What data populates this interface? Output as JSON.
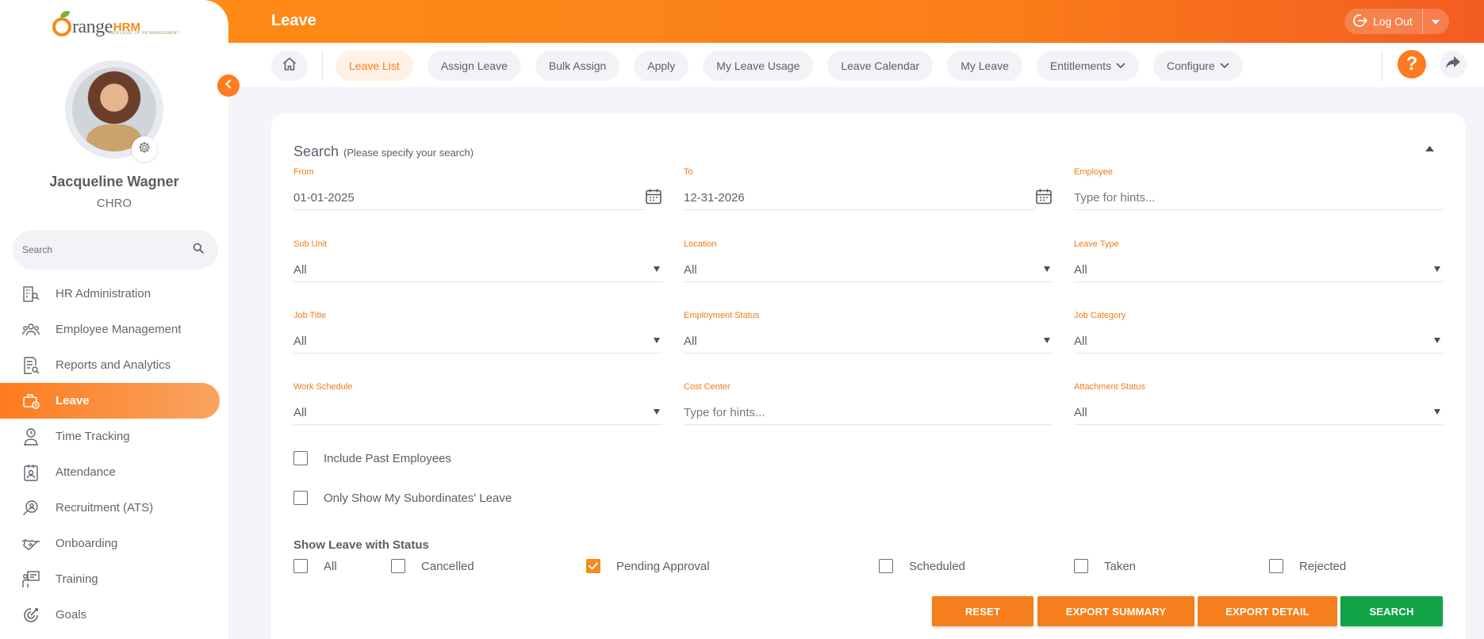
{
  "brand": {
    "logo_main": "range",
    "logo_hrm": "HRM",
    "logo_tagline": "NEW LEVEL OF HR MANAGEMENT",
    "accent": "#ff7b1d"
  },
  "user": {
    "name": "Jacqueline Wagner",
    "role": "CHRO"
  },
  "sidebar": {
    "search_placeholder": "Search",
    "items": [
      {
        "label": "HR Administration",
        "icon": "building-person-icon",
        "active": false
      },
      {
        "label": "Employee Management",
        "icon": "people-group-icon",
        "active": false
      },
      {
        "label": "Reports and Analytics",
        "icon": "report-search-icon",
        "active": false
      },
      {
        "label": "Leave",
        "icon": "suitcase-icon",
        "active": true
      },
      {
        "label": "Time Tracking",
        "icon": "clock-person-icon",
        "active": false
      },
      {
        "label": "Attendance",
        "icon": "attendance-badge-icon",
        "active": false
      },
      {
        "label": "Recruitment (ATS)",
        "icon": "recruit-search-icon",
        "active": false
      },
      {
        "label": "Onboarding",
        "icon": "handshake-icon",
        "active": false
      },
      {
        "label": "Training",
        "icon": "presentation-icon",
        "active": false
      },
      {
        "label": "Goals",
        "icon": "target-icon",
        "active": false
      }
    ]
  },
  "header": {
    "title": "Leave",
    "logout_label": "Log Out"
  },
  "subnav": {
    "tabs": [
      {
        "label": "Leave List",
        "active": true,
        "dropdown": false
      },
      {
        "label": "Assign Leave",
        "active": false,
        "dropdown": false
      },
      {
        "label": "Bulk Assign",
        "active": false,
        "dropdown": false
      },
      {
        "label": "Apply",
        "active": false,
        "dropdown": false
      },
      {
        "label": "My Leave Usage",
        "active": false,
        "dropdown": false
      },
      {
        "label": "Leave Calendar",
        "active": false,
        "dropdown": false
      },
      {
        "label": "My Leave",
        "active": false,
        "dropdown": false
      },
      {
        "label": "Entitlements",
        "active": false,
        "dropdown": true
      },
      {
        "label": "Configure",
        "active": false,
        "dropdown": true
      }
    ],
    "help_label": "?"
  },
  "search": {
    "title": "Search",
    "hint": "(Please specify your search)",
    "fields": {
      "from": {
        "label": "From",
        "value": "01-01-2025"
      },
      "to": {
        "label": "To",
        "value": "12-31-2026"
      },
      "employee": {
        "label": "Employee",
        "placeholder": "Type for hints..."
      },
      "sub_unit": {
        "label": "Sub Unit",
        "value": "All"
      },
      "location": {
        "label": "Location",
        "value": "All"
      },
      "leave_type": {
        "label": "Leave Type",
        "value": "All"
      },
      "job_title": {
        "label": "Job Title",
        "value": "All"
      },
      "employment_status": {
        "label": "Employment Status",
        "value": "All"
      },
      "job_category": {
        "label": "Job Category",
        "value": "All"
      },
      "work_schedule": {
        "label": "Work Schedule",
        "value": "All"
      },
      "cost_center": {
        "label": "Cost Center",
        "placeholder": "Type for hints..."
      },
      "attachment_status": {
        "label": "Attachment Status",
        "value": "All"
      }
    },
    "include_past": {
      "label": "Include Past Employees",
      "checked": false
    },
    "only_subordinates": {
      "label": "Only Show My Subordinates' Leave",
      "checked": false
    },
    "status_heading": "Show Leave with Status",
    "statuses": [
      {
        "label": "All",
        "checked": false
      },
      {
        "label": "Cancelled",
        "checked": false
      },
      {
        "label": "Pending Approval",
        "checked": true
      },
      {
        "label": "Scheduled",
        "checked": false
      },
      {
        "label": "Taken",
        "checked": false
      },
      {
        "label": "Rejected",
        "checked": false
      }
    ],
    "buttons": {
      "reset": "RESET",
      "export_summary": "EXPORT SUMMARY",
      "export_detail": "EXPORT DETAIL",
      "search": "SEARCH"
    }
  }
}
